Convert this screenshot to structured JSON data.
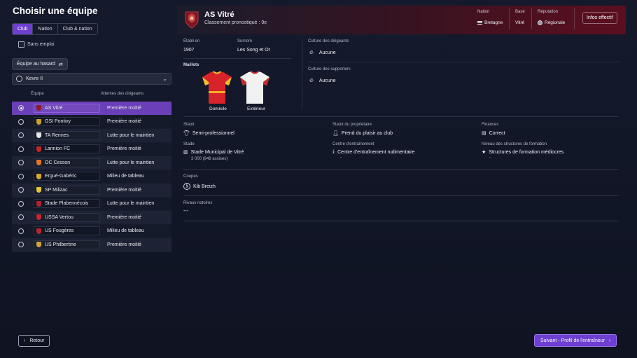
{
  "page": {
    "title": "Choisir une équipe"
  },
  "filters": {
    "tabs": [
      {
        "label": "Club",
        "active": true
      },
      {
        "label": "Nation",
        "active": false
      },
      {
        "label": "Club & nation",
        "active": false
      }
    ],
    "unemployed_label": "Sans emploi",
    "random_team_label": "Équipe au hasard",
    "league_select": "Kevre II"
  },
  "team_table": {
    "headers": {
      "team": "Équipe",
      "expectation": "Attentes des dirigeants"
    },
    "rows": [
      {
        "team": "AS Vitré",
        "expectation": "Première moitié",
        "selected": true,
        "crest_color": "#8b1a2b"
      },
      {
        "team": "GSI Pontivy",
        "expectation": "Première moitié",
        "selected": false,
        "crest_color": "#c9a227"
      },
      {
        "team": "TA Rennes",
        "expectation": "Lutte pour le maintien",
        "selected": false,
        "crest_color": "#e5e7eb"
      },
      {
        "team": "Lannion FC",
        "expectation": "Première moitié",
        "selected": false,
        "crest_color": "#c0262d"
      },
      {
        "team": "OC Cesson",
        "expectation": "Lutte pour le maintien",
        "selected": false,
        "crest_color": "#e0762a"
      },
      {
        "team": "Ergué-Gabéric",
        "expectation": "Milieu de tableau",
        "selected": false,
        "crest_color": "#d9a52c"
      },
      {
        "team": "SP Milizac",
        "expectation": "Première moitié",
        "selected": false,
        "crest_color": "#e6c53a"
      },
      {
        "team": "Stade Plabennécois",
        "expectation": "Lutte pour le maintien",
        "selected": false,
        "crest_color": "#b51f2e"
      },
      {
        "team": "USSA Vertou",
        "expectation": "Première moitié",
        "selected": false,
        "crest_color": "#c8262f"
      },
      {
        "team": "US Fougères",
        "expectation": "Milieu de tableau",
        "selected": false,
        "crest_color": "#b82331"
      },
      {
        "team": "US Philbertine",
        "expectation": "Première moitié",
        "selected": false,
        "crest_color": "#d0a23a"
      }
    ]
  },
  "club": {
    "name": "AS Vitré",
    "prognosis": "Classement pronostiqué : 9e",
    "nation_label": "Nation",
    "nation": "Bretagne",
    "based_label": "Basé",
    "based": "Vitré",
    "reputation_label": "Réputation",
    "reputation": "Régionale",
    "squad_button": "Infos effectif",
    "founded_label": "Établi en",
    "founded": "1907",
    "nickname_label": "Surnom",
    "nickname": "Les Song et Or",
    "kits_label": "Maillots",
    "home_kit": "Domicile",
    "away_kit": "Extérieur",
    "board_culture_label": "Culture des dirigeants",
    "board_culture": "Aucune",
    "fan_culture_label": "Culture des supporters",
    "fan_culture": "Aucune",
    "status_label": "Statut",
    "status": "Semi-professionnel",
    "owner_label": "Statut du propriétaire",
    "owner": "Prend du plaisir au club",
    "finances_label": "Finances",
    "finances": "Correct",
    "stadium_label": "Stade",
    "stadium": "Stade Municipal de Vitré",
    "stadium_capacity": "3 000 (948 assises)",
    "training_label": "Centre d'entraînement",
    "training": "Centre d'entraînement rudimentaire",
    "training_sub": "-",
    "youth_label": "Niveau des structures de formation",
    "youth": "Structures de formation médiocres",
    "youth_sub": "-",
    "cups_label": "Coupes",
    "cup": "Kib Breizh",
    "rivals_label": "Rivaux notoires",
    "rivals": "---"
  },
  "footer": {
    "back_label": "Retour",
    "next_label": "Suivant - Profil de l'entraîneur"
  },
  "colors": {
    "accent": "#6d3fd2",
    "header_red": "#5c0f1e",
    "home_kit": "#d8232a",
    "away_kit": "#f1f1f1"
  }
}
